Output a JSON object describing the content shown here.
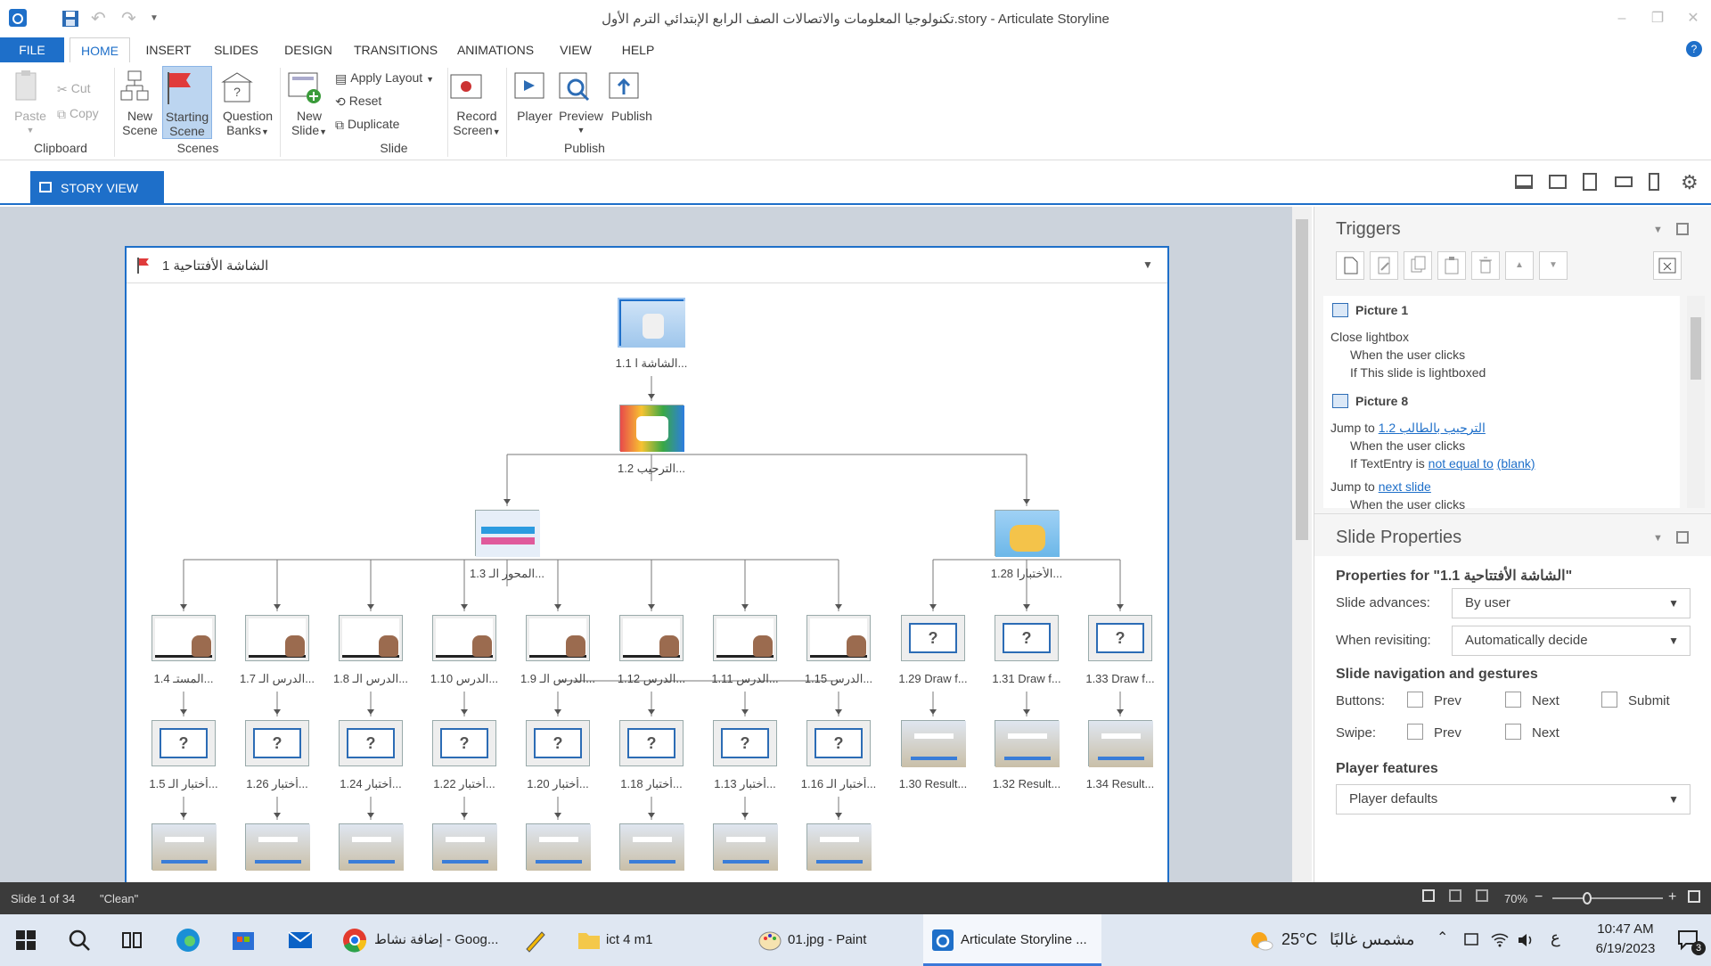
{
  "window": {
    "title": "تكنولوجيا المعلومات والاتصالات الصف الرابع الإبتدائي الترم الأول.story - Articulate Storyline",
    "controls": [
      "–",
      "❐",
      "✕"
    ]
  },
  "tabs": [
    {
      "label": "FILE"
    },
    {
      "label": "HOME",
      "active": true
    },
    {
      "label": "INSERT"
    },
    {
      "label": "SLIDES"
    },
    {
      "label": "DESIGN"
    },
    {
      "label": "TRANSITIONS"
    },
    {
      "label": "ANIMATIONS"
    },
    {
      "label": "VIEW"
    },
    {
      "label": "HELP"
    }
  ],
  "ribbon": {
    "paste": "Paste",
    "cut": "Cut",
    "copy": "Copy",
    "clipboard": "Clipboard",
    "new_scene": "New Scene",
    "starting_scene": "Starting Scene",
    "question_banks": "Question Banks",
    "scenes": "Scenes",
    "new_slide": "New Slide",
    "apply_layout": "Apply Layout",
    "reset": "Reset",
    "duplicate": "Duplicate",
    "slide": "Slide",
    "record_screen": "Record Screen",
    "player": "Player",
    "preview": "Preview",
    "publish_btn": "Publish",
    "publish_group": "Publish"
  },
  "view": {
    "story_view": "STORY VIEW"
  },
  "scene": {
    "title": "الشاشة الأفتتاحية 1",
    "nodes": [
      {
        "label": "1.1 الشاشة ا...",
        "kind": "title"
      },
      {
        "label": "1.2 الترحيب...",
        "kind": "welcome"
      },
      {
        "label": "1.3 المحور الـ...",
        "kind": "menu"
      },
      {
        "label": "1.28 الأختبارا...",
        "kind": "kids"
      },
      {
        "label": "1.4 المستـ...",
        "kind": "hand"
      },
      {
        "label": "1.7 الدرس الـ...",
        "kind": "hand"
      },
      {
        "label": "1.8 الدرس الـ...",
        "kind": "hand"
      },
      {
        "label": "1.10 الدرس...",
        "kind": "hand"
      },
      {
        "label": "1.9 الدرس الـ...",
        "kind": "hand"
      },
      {
        "label": "1.12 الدرس...",
        "kind": "hand"
      },
      {
        "label": "1.11 الدرس...",
        "kind": "hand"
      },
      {
        "label": "1.15 الدرس...",
        "kind": "hand"
      },
      {
        "label": "1.29 Draw f...",
        "kind": "q"
      },
      {
        "label": "1.31 Draw f...",
        "kind": "q"
      },
      {
        "label": "1.33 Draw f...",
        "kind": "q"
      },
      {
        "label": "1.5 أختبار الـ...",
        "kind": "q"
      },
      {
        "label": "1.26 أختبار...",
        "kind": "q"
      },
      {
        "label": "1.24 أختبار...",
        "kind": "q"
      },
      {
        "label": "1.22 أختبار...",
        "kind": "q"
      },
      {
        "label": "1.20 أختبار...",
        "kind": "q"
      },
      {
        "label": "1.18 أختبار...",
        "kind": "q"
      },
      {
        "label": "1.13 أختبار...",
        "kind": "q"
      },
      {
        "label": "1.16 أختبار الـ...",
        "kind": "q"
      },
      {
        "label": "1.30 Result...",
        "kind": "result"
      },
      {
        "label": "1.32 Result...",
        "kind": "result"
      },
      {
        "label": "1.34 Result...",
        "kind": "result"
      },
      {
        "label": "",
        "kind": "result"
      },
      {
        "label": "",
        "kind": "result"
      },
      {
        "label": "",
        "kind": "result"
      },
      {
        "label": "",
        "kind": "result"
      },
      {
        "label": "",
        "kind": "result"
      },
      {
        "label": "",
        "kind": "result"
      },
      {
        "label": "",
        "kind": "result"
      },
      {
        "label": "",
        "kind": "result"
      }
    ]
  },
  "triggers": {
    "title": "Triggers",
    "picture1": "Picture 1",
    "close_lightbox": "Close lightbox",
    "when_clicks_1": "When the user clicks",
    "if_lightboxed": "If This slide is lightboxed",
    "picture8": "Picture 8",
    "jump_to_1": "Jump to",
    "jump_target_1": "1.2 الترحيب بالطالب",
    "when_clicks_2": "When the user clicks",
    "if_textentry": "If TextEntry is",
    "not_equal": "not equal to",
    "blank": "(blank)",
    "jump_to_2": "Jump to",
    "next_slide": "next slide",
    "when_clicks_3": "When the user clicks"
  },
  "slide_properties": {
    "title": "Slide Properties",
    "properties_for": "Properties for \"1.1 الشاشة الأفتتاحية\"",
    "slide_advances_label": "Slide advances:",
    "slide_advances_value": "By user",
    "when_revisiting_label": "When revisiting:",
    "when_revisiting_value": "Automatically decide",
    "nav_title": "Slide navigation and gestures",
    "buttons_label": "Buttons:",
    "prev": "Prev",
    "next": "Next",
    "submit": "Submit",
    "swipe_label": "Swipe:",
    "swipe_prev": "Prev",
    "swipe_next": "Next",
    "player_features": "Player features",
    "player_features_value": "Player defaults"
  },
  "status": {
    "slide_count": "Slide 1 of 34",
    "theme": "\"Clean\"",
    "zoom": "70%"
  },
  "taskbar": {
    "apps": [
      {
        "label": "إضافة نشاط - Goog...",
        "icon": "chrome-icon"
      },
      {
        "label": "ict 4  m1",
        "icon": "folder-icon"
      },
      {
        "label": "01.jpg - Paint",
        "icon": "paint-icon"
      },
      {
        "label": "Articulate Storyline ...",
        "icon": "storyline-icon",
        "active": true
      }
    ],
    "weather": "25°C",
    "weather_text": "مشمس غالبًا",
    "lang": "ع",
    "time": "10:47 AM",
    "date": "6/19/2023",
    "notif_count": "3"
  }
}
